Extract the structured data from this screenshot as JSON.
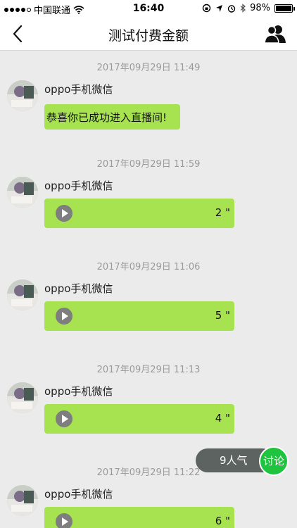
{
  "status_bar": {
    "carrier": "中国联通",
    "time": "16:40",
    "battery": "98%",
    "battery_level": 0.98,
    "icons": [
      "signal-dots-icon",
      "wifi-icon",
      "rotation-lock-icon",
      "location-icon",
      "alarm-icon",
      "bluetooth-icon",
      "battery-icon"
    ]
  },
  "nav": {
    "title": "测试付费金额",
    "back_icon": "chevron-left-icon",
    "right_icon": "group-users-icon"
  },
  "messages": [
    {
      "timestamp": "2017年09月29日 11:49",
      "sender": "oppo手机微信",
      "type": "text",
      "text": "恭喜你已成功进入直播间!"
    },
    {
      "timestamp": "2017年09月29日 11:59",
      "sender": "oppo手机微信",
      "type": "voice",
      "duration": "2 \""
    },
    {
      "timestamp": "2017年09月29日 11:06",
      "sender": "oppo手机微信",
      "type": "voice",
      "duration": "5 \""
    },
    {
      "timestamp": "2017年09月29日 11:13",
      "sender": "oppo手机微信",
      "type": "voice",
      "duration": "4 \""
    },
    {
      "timestamp": "2017年09月29日 11:22",
      "sender": "oppo手机微信",
      "type": "voice",
      "duration": "6 \""
    }
  ],
  "popularity": "9人气",
  "discuss": "讨论",
  "colors": {
    "bubble": "#a7e351",
    "discuss": "#1fc43e",
    "pill": "#5c6360",
    "background": "#ebebeb"
  }
}
